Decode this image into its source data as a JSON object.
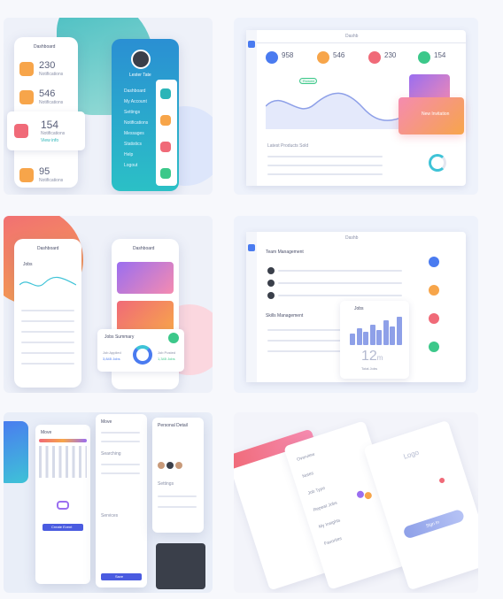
{
  "colors": {
    "teal": "#2bb5b8",
    "cyan": "#3ec3d7",
    "coral": "#f06a78",
    "orange": "#f7a54a",
    "blue": "#4a7bf0",
    "purple": "#9a6ef0",
    "green": "#3cc88a",
    "pink": "#f58bb0"
  },
  "tile1": {
    "left_phone": {
      "title": "Dashboard",
      "stat1_value": "230",
      "stat1_label": "Notifications",
      "stat2_value": "546",
      "stat2_label": "Notifications",
      "stat3_value": "154",
      "stat3_label": "Notifications",
      "stat3_link": "View info",
      "stat4_value": "95",
      "stat4_label": "Notifications"
    },
    "right_phone": {
      "profile_name": "Lester Tate",
      "menu": [
        "Dashboard",
        "My Account",
        "Settings",
        "Notifications",
        "Messages",
        "Statistics",
        "Help",
        "Logout"
      ]
    }
  },
  "tile2": {
    "header_title": "Dashb",
    "stat1_value": "958",
    "stat2_value": "546",
    "stat3_value": "230",
    "stat4_value": "154",
    "pill_label": "Rowwn",
    "card_label": "New Invitation",
    "table_title": "Latest Products Sold"
  },
  "tile3": {
    "phone1_title": "Dashboard",
    "phone1_tab": "Jobs",
    "phone2_title": "Dashboard",
    "popup_title": "Jobs Summary",
    "popup_left_label": "Job Applied",
    "popup_left_value": "3,845 Jobs",
    "popup_right_label": "Job Posted",
    "popup_right_value": "1,345 Jobs"
  },
  "tile4": {
    "header_title": "Dashb",
    "section1_title": "Team Management",
    "section2_title": "Skills Management",
    "chart_title": "Jobs",
    "big_value": "12",
    "big_value_unit": "m",
    "big_value_caption": "Total Jobs",
    "bars": [
      12,
      18,
      14,
      22,
      16,
      26,
      20,
      30
    ]
  },
  "tile5": {
    "calendar_title": "Move",
    "create_button": "Create Event",
    "list_title": "Move",
    "list_section": "Searching",
    "list_section2": "Services",
    "settings_title": "Settings",
    "profile_title": "Personal Detail",
    "save_button": "Save"
  },
  "tile6": {
    "brand": "Logo",
    "login_button": "Sign In",
    "list_items": [
      "Overview",
      "Notes",
      "Job Type",
      "Repeat Jobs",
      "My Insights",
      "Favorites"
    ]
  }
}
